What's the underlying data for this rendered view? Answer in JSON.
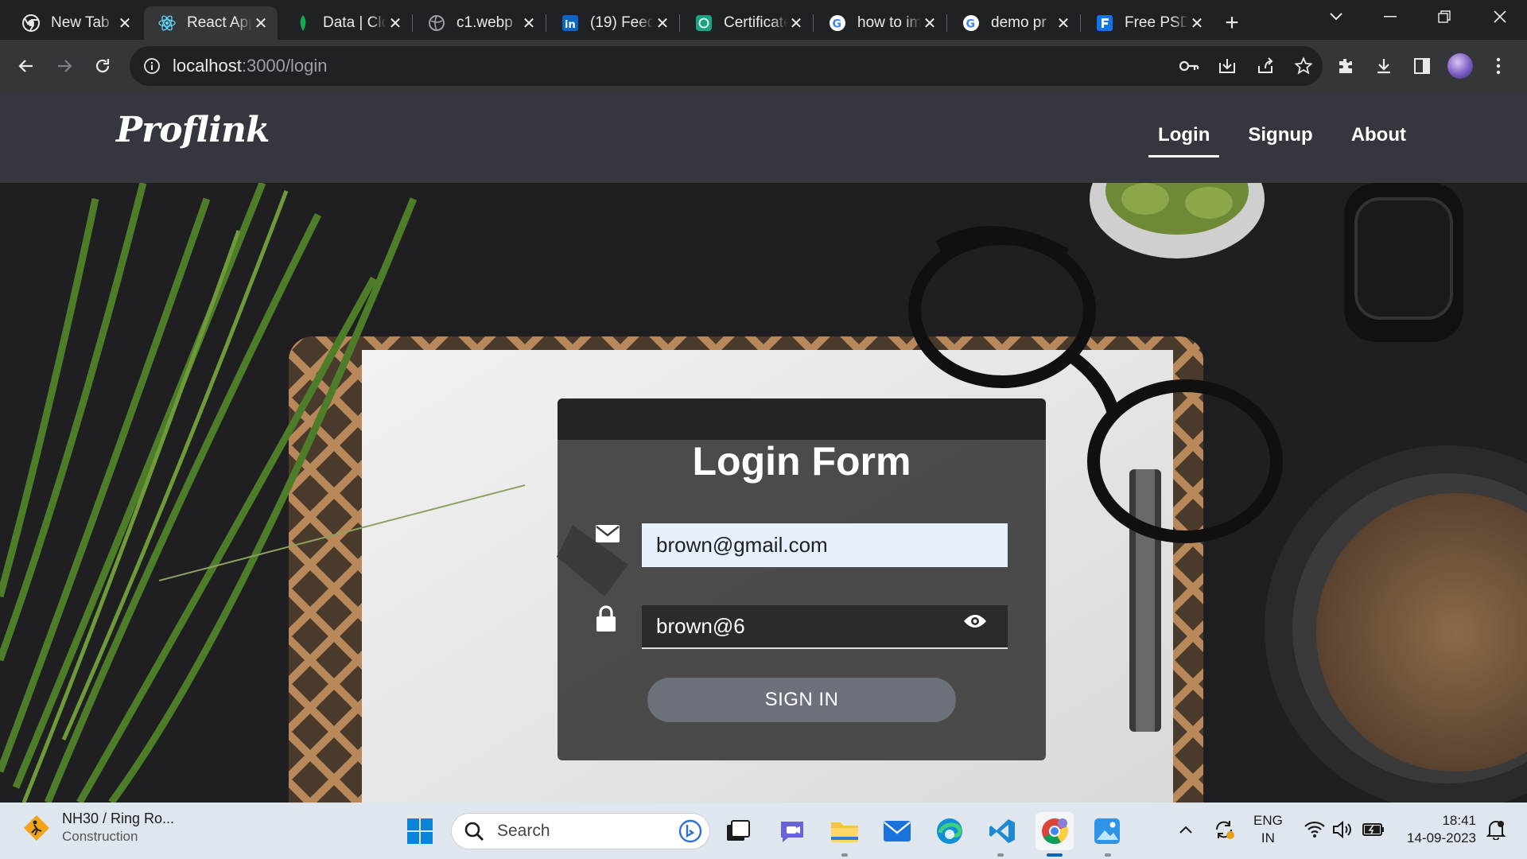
{
  "browser": {
    "tabs": [
      {
        "title": "New Tab",
        "icon": "chrome-icon"
      },
      {
        "title": "React App",
        "icon": "react-icon",
        "active": true
      },
      {
        "title": "Data | Cloud",
        "icon": "mongodb-leaf-icon"
      },
      {
        "title": "c1.webp",
        "icon": "globe-icon"
      },
      {
        "title": "(19) Feed",
        "icon": "linkedin-icon"
      },
      {
        "title": "Certificate",
        "icon": "chatgpt-icon"
      },
      {
        "title": "how to im",
        "icon": "google-icon"
      },
      {
        "title": "demo pr",
        "icon": "google-icon"
      },
      {
        "title": "Free PSD",
        "icon": "freepik-icon"
      }
    ],
    "url_host": "localhost",
    "url_rest": ":3000/login"
  },
  "site": {
    "brand": "Proflink",
    "nav": [
      {
        "label": "Login",
        "active": true
      },
      {
        "label": "Signup"
      },
      {
        "label": "About"
      }
    ]
  },
  "form": {
    "title": "Login Form",
    "email_value": "brown@gmail.com",
    "password_value": "brown@6",
    "submit_label": "SIGN IN"
  },
  "taskbar": {
    "weather_line1": "NH30 / Ring Ro...",
    "weather_line2": "Construction",
    "search_placeholder": "Search",
    "lang_line1": "ENG",
    "lang_line2": "IN",
    "time": "18:41",
    "date": "14-09-2023"
  },
  "colors": {
    "navbar": "#35373e",
    "card": "#3e3e40",
    "button": "#6b7079",
    "email_field": "#e8f0fe"
  }
}
